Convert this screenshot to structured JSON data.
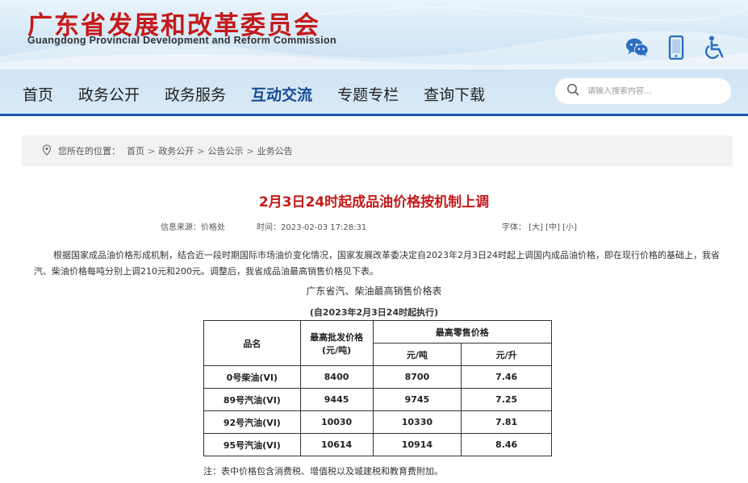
{
  "header": {
    "title_cn": "广东省发展和改革委员会",
    "title_en": "Guangdong Provincial Development and Reform Commission",
    "icons": [
      "wechat-icon",
      "mobile-icon",
      "accessibility-icon"
    ]
  },
  "nav": {
    "items": [
      {
        "label": "首页"
      },
      {
        "label": "政务公开"
      },
      {
        "label": "政务服务"
      },
      {
        "label": "互动交流"
      },
      {
        "label": "专题专栏"
      },
      {
        "label": "查询下载"
      }
    ],
    "search_placeholder": "请输入搜索内容..."
  },
  "breadcrumb": {
    "label": "您所在的位置：",
    "items": [
      "首页",
      "政务公开",
      "公告公示",
      "业务公告"
    ]
  },
  "article": {
    "title": "2月3日24时起成品油价格按机制上调",
    "source": "信息来源：价格处",
    "time": "时间：2023-02-03 17:28:31",
    "font_label": "字体：",
    "font_sizes": [
      "[大]",
      "[中]",
      "[小]"
    ],
    "paragraph": "根据国家成品油价格形成机制，结合近一段时期国际市场油价变化情况，国家发展改革委决定自2023年2月3日24时起上调国内成品油价格，即在现行价格的基础上，我省汽、柴油价格每吨分别上调210元和200元。调整后，我省成品油最高销售价格见下表。",
    "table_caption": "广东省汽、柴油最高销售价格表",
    "table_subcaption": "(自2023年2月3日24时起执行)",
    "table": {
      "col_name": "品名",
      "col_wholesale": "最高批发价格",
      "col_wholesale_unit": "(元/吨)",
      "col_retail": "最高零售价格",
      "col_retail_ton": "元/吨",
      "col_retail_liter": "元/升",
      "rows": [
        {
          "name": "0号柴油(VI)",
          "wholesale": "8400",
          "retail_ton": "8700",
          "retail_liter": "7.46"
        },
        {
          "name": "89号汽油(VI)",
          "wholesale": "9445",
          "retail_ton": "9745",
          "retail_liter": "7.25"
        },
        {
          "name": "92号汽油(VI)",
          "wholesale": "10030",
          "retail_ton": "10330",
          "retail_liter": "7.81"
        },
        {
          "name": "95号汽油(VI)",
          "wholesale": "10614",
          "retail_ton": "10914",
          "retail_liter": "8.46"
        }
      ]
    },
    "note": "注：表中价格包含消费税、增值税以及城建税和教育费附加。"
  },
  "colors": {
    "brand_red": "#c41a1a",
    "nav_active": "#1a4c93",
    "nav_border": "#1f5aa8",
    "icon_blue": "#2c6fc2"
  }
}
